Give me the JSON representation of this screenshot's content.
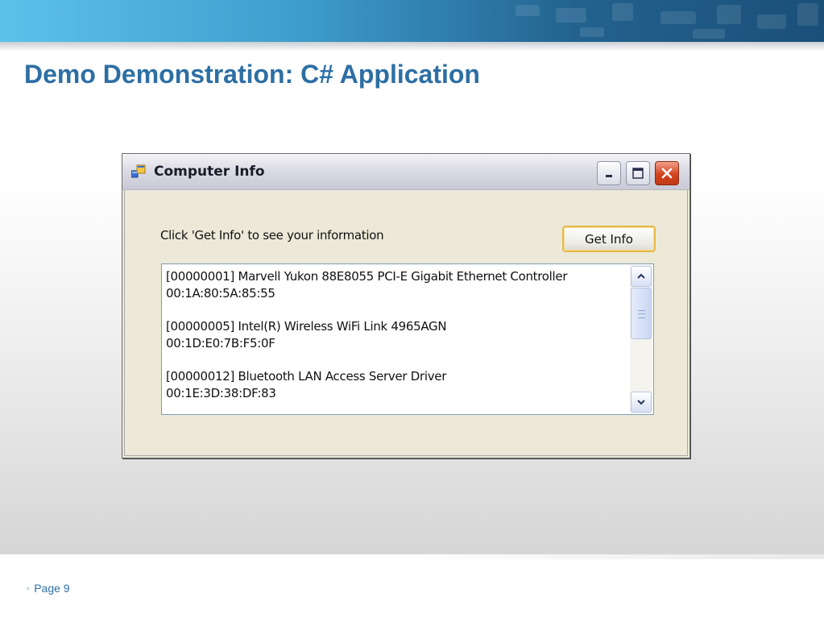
{
  "slide": {
    "title": "Demo Demonstration: C# Application",
    "page_label": "Page 9",
    "bullet": "▫",
    "accent_color": "#2d6fa4"
  },
  "window": {
    "title": "Computer Info",
    "icon": "application-icon",
    "controls": {
      "minimize": "minimize-icon",
      "maximize": "maximize-icon",
      "close": "close-icon"
    },
    "prompt": "Click 'Get Info' to see your information",
    "get_info_label": "Get Info",
    "list": {
      "entries": [
        {
          "name": "[00000001] Marvell Yukon 88E8055 PCI-E Gigabit Ethernet Controller",
          "mac": "00:1A:80:5A:85:55"
        },
        {
          "name": "[00000005] Intel(R) Wireless WiFi Link 4965AGN",
          "mac": "00:1D:E0:7B:F5:0F"
        },
        {
          "name": "[00000012] Bluetooth LAN Access Server Driver",
          "mac": "00:1E:3D:38:DF:83"
        }
      ]
    }
  }
}
